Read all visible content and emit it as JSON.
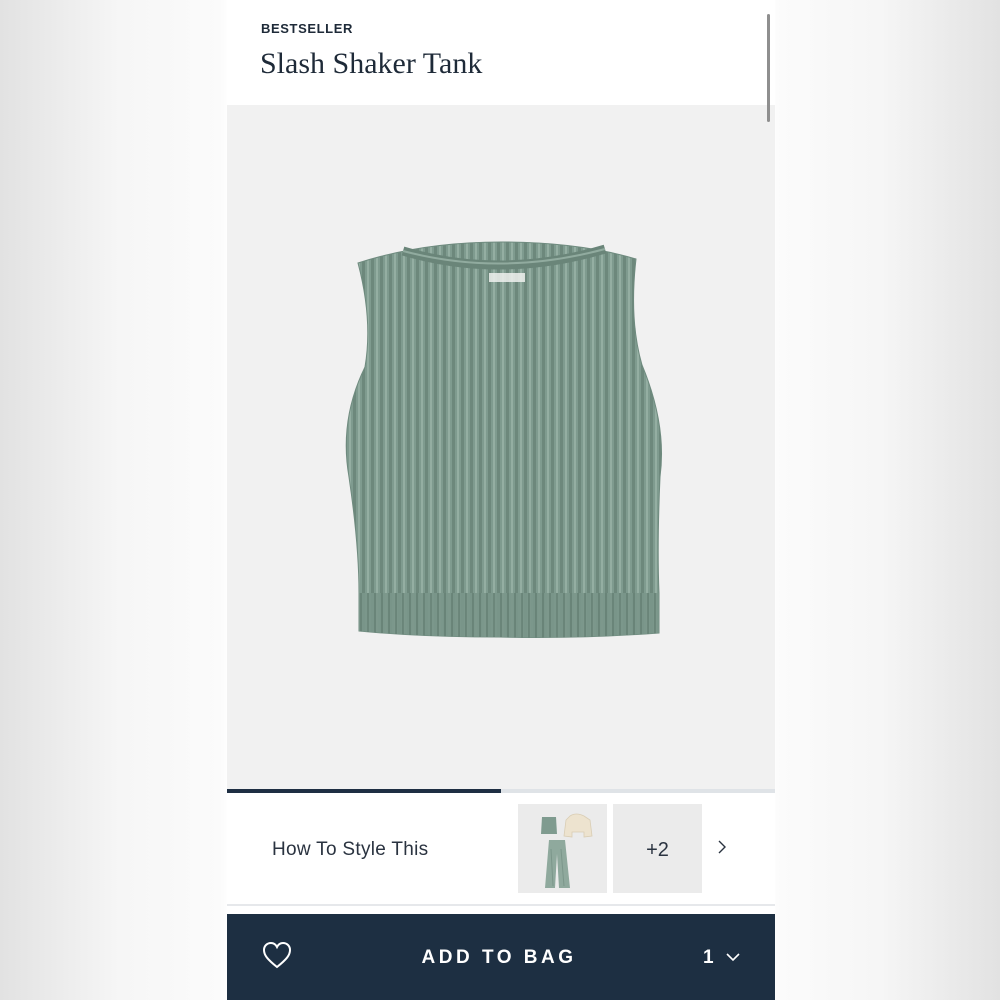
{
  "product": {
    "badge": "BESTSELLER",
    "title": "Slash Shaker Tank",
    "image_icon": "ribbed-knit-tank-image",
    "color": "#7e9a8e"
  },
  "gallery": {
    "progress_fraction": 0.5
  },
  "style_section": {
    "label": "How To Style This",
    "more_count_label": "+2",
    "arrow_icon": "chevron-right-icon"
  },
  "bag_bar": {
    "wishlist_icon": "heart-icon",
    "add_label": "ADD TO BAG",
    "quantity": "1",
    "quantity_icon": "chevron-down-icon",
    "background": "#1d2f42"
  }
}
